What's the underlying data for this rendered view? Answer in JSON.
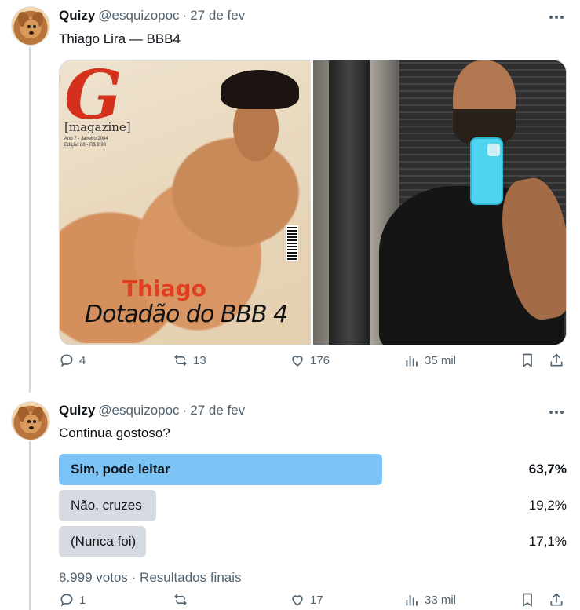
{
  "tweet1": {
    "author_name": "Quizy",
    "handle": "@esquizopoc",
    "separator": "·",
    "date": "27 de fev",
    "text": "Thiago Lira — BBB4",
    "media": {
      "left_logo": "G",
      "left_magazine": "[magazine]",
      "left_issue": "Ano 7 - Janeiro/2004 Edição 88 - R$ 9,90",
      "left_caption_name": "Thiago",
      "left_caption_line": "Dotadão do BBB 4"
    },
    "actions": {
      "replies": "4",
      "retweets": "13",
      "likes": "176",
      "views": "35 mil"
    }
  },
  "tweet2": {
    "author_name": "Quizy",
    "handle": "@esquizopoc",
    "separator": "·",
    "date": "27 de fev",
    "text": "Continua gostoso?",
    "poll": {
      "options": [
        {
          "label": "Sim, pode leitar",
          "percent": "63,7%",
          "fraction": 0.637,
          "winner": true
        },
        {
          "label": "Não, cruzes",
          "percent": "19,2%",
          "fraction": 0.192,
          "winner": false
        },
        {
          "label": "(Nunca foi)",
          "percent": "17,1%",
          "fraction": 0.171,
          "winner": false
        }
      ],
      "votes": "8.999 votos",
      "status": "Resultados finais"
    },
    "actions": {
      "replies": "1",
      "likes": "17",
      "views": "33 mil"
    }
  },
  "colors": {
    "poll_winner": "#7cc3f5",
    "poll_other": "#d5dbe0",
    "secondary_text": "#536471"
  }
}
